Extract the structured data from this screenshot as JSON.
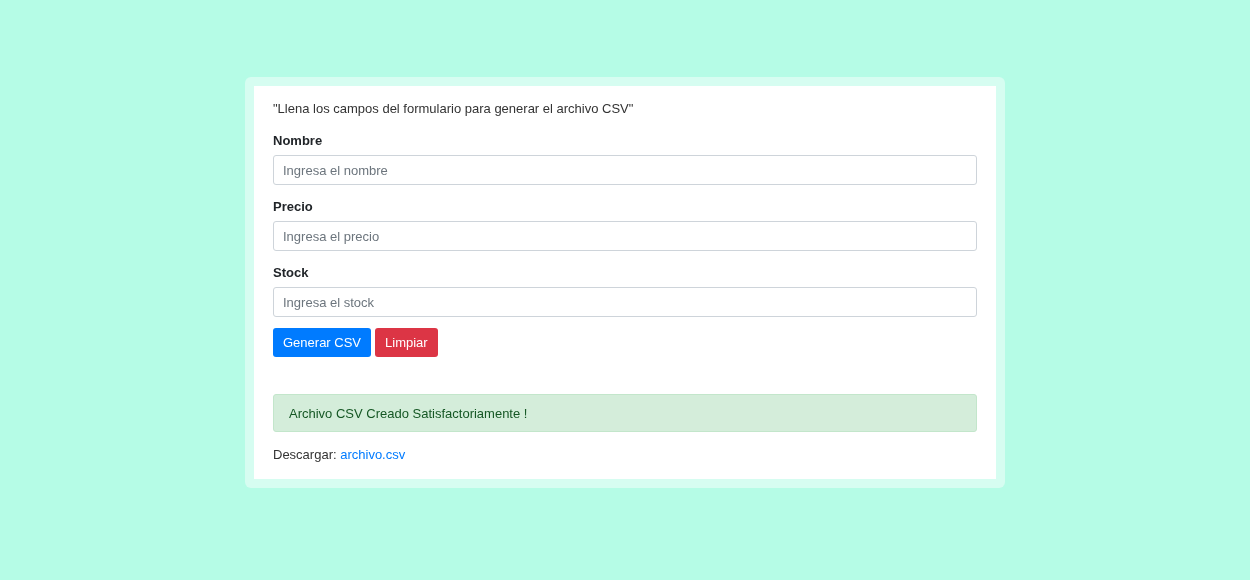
{
  "intro": "\"Llena los campos del formulario para generar el archivo CSV\"",
  "fields": [
    {
      "label": "Nombre",
      "placeholder": "Ingresa el nombre"
    },
    {
      "label": "Precio",
      "placeholder": "Ingresa el precio"
    },
    {
      "label": "Stock",
      "placeholder": "Ingresa el stock"
    }
  ],
  "buttons": [
    {
      "label": "Generar CSV",
      "kind": "primary"
    },
    {
      "label": "Limpiar",
      "kind": "danger"
    }
  ],
  "alert": {
    "text": "Archivo CSV Creado Satisfactoriamente !",
    "kind": "success"
  },
  "download": {
    "label": "Descargar:",
    "link": "archivo.csv"
  }
}
